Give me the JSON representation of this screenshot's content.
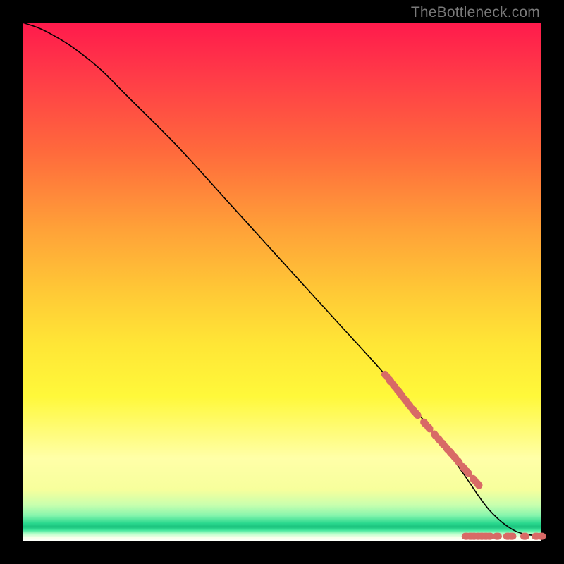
{
  "watermark": "TheBottleneck.com",
  "colors": {
    "point": "#d86a66",
    "curve": "#000000"
  },
  "chart_data": {
    "type": "line",
    "title": "",
    "xlabel": "",
    "ylabel": "",
    "xlim": [
      0,
      100
    ],
    "ylim": [
      0,
      100
    ],
    "grid": false,
    "legend": false,
    "series": [
      {
        "name": "curve",
        "kind": "line",
        "x": [
          0,
          3,
          6,
          10,
          15,
          20,
          30,
          40,
          50,
          60,
          70,
          80,
          85,
          90,
          95,
          100
        ],
        "y": [
          100,
          99,
          97.5,
          95,
          91,
          86,
          76,
          65,
          54,
          43,
          32,
          20,
          13,
          6,
          2,
          1
        ]
      },
      {
        "name": "markers-on-slope",
        "kind": "scatter",
        "x": [
          70.0,
          70.8,
          71.6,
          72.4,
          73.0,
          73.8,
          74.5,
          75.3,
          76.0,
          77.5,
          78.3,
          79.5,
          80.3,
          81.0,
          81.8,
          82.5,
          83.3,
          84.0,
          85.0,
          85.8,
          87.0,
          87.8
        ],
        "y": [
          32.0,
          31.0,
          30.0,
          29.0,
          28.2,
          27.2,
          26.3,
          25.3,
          24.5,
          22.8,
          21.9,
          20.5,
          19.6,
          18.8,
          17.9,
          17.1,
          16.2,
          15.4,
          14.2,
          13.3,
          11.9,
          11.0
        ]
      },
      {
        "name": "markers-bottom",
        "kind": "scatter",
        "x": [
          85.5,
          86.3,
          87.0,
          87.8,
          88.5,
          89.3,
          90.0,
          91.5,
          93.5,
          94.3,
          96.8,
          99.0,
          100.0
        ],
        "y": [
          1.0,
          1.0,
          1.0,
          1.0,
          1.0,
          1.0,
          1.0,
          1.0,
          1.0,
          1.0,
          1.0,
          1.0,
          1.0
        ]
      }
    ]
  }
}
